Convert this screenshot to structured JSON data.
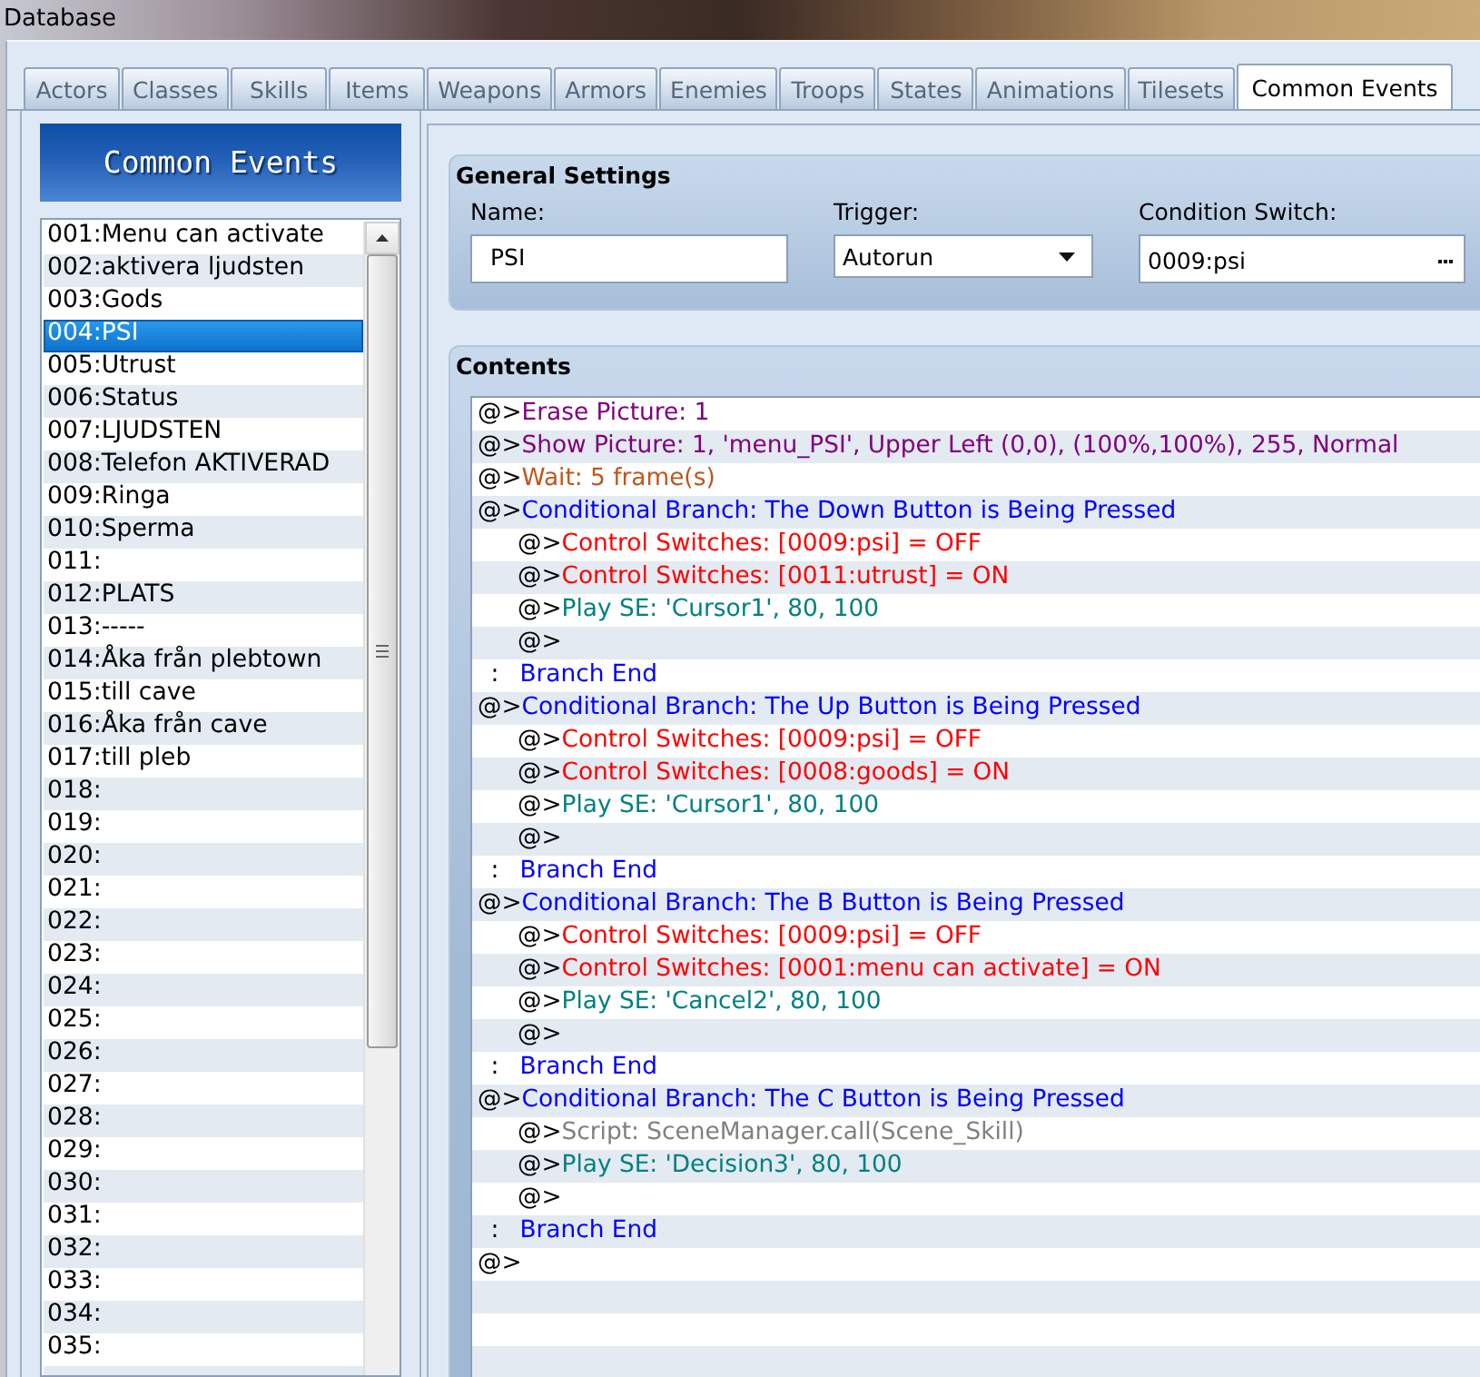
{
  "window": {
    "title": "Database"
  },
  "tabs": [
    {
      "label": "Actors",
      "selected": false
    },
    {
      "label": "Classes",
      "selected": false
    },
    {
      "label": "Skills",
      "selected": false
    },
    {
      "label": "Items",
      "selected": false
    },
    {
      "label": "Weapons",
      "selected": false
    },
    {
      "label": "Armors",
      "selected": false
    },
    {
      "label": "Enemies",
      "selected": false
    },
    {
      "label": "Troops",
      "selected": false
    },
    {
      "label": "States",
      "selected": false
    },
    {
      "label": "Animations",
      "selected": false
    },
    {
      "label": "Tilesets",
      "selected": false
    },
    {
      "label": "Common Events",
      "selected": true
    }
  ],
  "sidebar": {
    "title": "Common Events",
    "items": [
      {
        "label": "001:Menu can activate",
        "selected": false
      },
      {
        "label": "002:aktivera ljudsten",
        "selected": false
      },
      {
        "label": "003:Gods",
        "selected": false
      },
      {
        "label": "004:PSI",
        "selected": true
      },
      {
        "label": "005:Utrust",
        "selected": false
      },
      {
        "label": "006:Status",
        "selected": false
      },
      {
        "label": "007:LJUDSTEN",
        "selected": false
      },
      {
        "label": "008:Telefon AKTIVERAD",
        "selected": false
      },
      {
        "label": "009:Ringa",
        "selected": false
      },
      {
        "label": "010:Sperma",
        "selected": false
      },
      {
        "label": "011:",
        "selected": false
      },
      {
        "label": "012:PLATS",
        "selected": false
      },
      {
        "label": "013:-----",
        "selected": false
      },
      {
        "label": "014:Åka från plebtown",
        "selected": false
      },
      {
        "label": "015:till cave",
        "selected": false
      },
      {
        "label": "016:Åka från cave",
        "selected": false
      },
      {
        "label": "017:till pleb",
        "selected": false
      },
      {
        "label": "018:",
        "selected": false
      },
      {
        "label": "019:",
        "selected": false
      },
      {
        "label": "020:",
        "selected": false
      },
      {
        "label": "021:",
        "selected": false
      },
      {
        "label": "022:",
        "selected": false
      },
      {
        "label": "023:",
        "selected": false
      },
      {
        "label": "024:",
        "selected": false
      },
      {
        "label": "025:",
        "selected": false
      },
      {
        "label": "026:",
        "selected": false
      },
      {
        "label": "027:",
        "selected": false
      },
      {
        "label": "028:",
        "selected": false
      },
      {
        "label": "029:",
        "selected": false
      },
      {
        "label": "030:",
        "selected": false
      },
      {
        "label": "031:",
        "selected": false
      },
      {
        "label": "032:",
        "selected": false
      },
      {
        "label": "033:",
        "selected": false
      },
      {
        "label": "034:",
        "selected": false
      },
      {
        "label": "035:",
        "selected": false
      }
    ]
  },
  "general_settings": {
    "title": "General Settings",
    "name": {
      "label": "Name:",
      "value": "PSI"
    },
    "trigger": {
      "label": "Trigger:",
      "value": "Autorun"
    },
    "condition_switch": {
      "label": "Condition Switch:",
      "value": "0009:psi"
    }
  },
  "contents": {
    "title": "Contents",
    "commands": [
      {
        "kind": "command",
        "marker": "@>",
        "text": "Erase Picture: 1",
        "color": "#800080"
      },
      {
        "kind": "command",
        "marker": "@>",
        "text": "Show Picture: 1, 'menu_PSI', Upper Left (0,0), (100%,100%), 255, Normal",
        "color": "#800080"
      },
      {
        "kind": "command",
        "marker": "@>",
        "text": "Wait: 5 frame(s)",
        "color": "#c0561b"
      },
      {
        "kind": "command",
        "marker": "@>",
        "text": "Conditional Branch: The Down Button is Being Pressed",
        "color": "#0000ff",
        "children": [
          {
            "kind": "command",
            "marker": "@>",
            "text": "Control Switches: [0009:psi] = OFF",
            "color": "#ff0000"
          },
          {
            "kind": "command",
            "marker": "@>",
            "text": "Control Switches: [0011:utrust] = ON",
            "color": "#ff0000"
          },
          {
            "kind": "command",
            "marker": "@>",
            "text": "Play SE: 'Cursor1', 80, 100",
            "color": "#008080"
          },
          {
            "kind": "command",
            "marker": "@>"
          }
        ]
      },
      {
        "kind": "branch_end",
        "marker": ":",
        "text": "Branch End",
        "color": "#0000ff"
      },
      {
        "kind": "command",
        "marker": "@>",
        "text": "Conditional Branch: The Up Button is Being Pressed",
        "color": "#0000ff",
        "children": [
          {
            "kind": "command",
            "marker": "@>",
            "text": "Control Switches: [0009:psi] = OFF",
            "color": "#ff0000"
          },
          {
            "kind": "command",
            "marker": "@>",
            "text": "Control Switches: [0008:goods] = ON",
            "color": "#ff0000"
          },
          {
            "kind": "command",
            "marker": "@>",
            "text": "Play SE: 'Cursor1', 80, 100",
            "color": "#008080"
          },
          {
            "kind": "command",
            "marker": "@>"
          }
        ]
      },
      {
        "kind": "branch_end",
        "marker": ":",
        "text": "Branch End",
        "color": "#0000ff"
      },
      {
        "kind": "command",
        "marker": "@>",
        "text": "Conditional Branch: The B Button is Being Pressed",
        "color": "#0000ff",
        "children": [
          {
            "kind": "command",
            "marker": "@>",
            "text": "Control Switches: [0009:psi] = OFF",
            "color": "#ff0000"
          },
          {
            "kind": "command",
            "marker": "@>",
            "text": "Control Switches: [0001:menu can activate] = ON",
            "color": "#ff0000"
          },
          {
            "kind": "command",
            "marker": "@>",
            "text": "Play SE: 'Cancel2', 80, 100",
            "color": "#008080"
          },
          {
            "kind": "command",
            "marker": "@>"
          }
        ]
      },
      {
        "kind": "branch_end",
        "marker": ":",
        "text": "Branch End",
        "color": "#0000ff"
      },
      {
        "kind": "command",
        "marker": "@>",
        "text": "Conditional Branch: The C Button is Being Pressed",
        "color": "#0000ff",
        "children": [
          {
            "kind": "command",
            "marker": "@>",
            "text": "Script: SceneManager.call(Scene_Skill)",
            "color": "#808080"
          },
          {
            "kind": "command",
            "marker": "@>",
            "text": "Play SE: 'Decision3', 80, 100",
            "color": "#008080"
          },
          {
            "kind": "command",
            "marker": "@>"
          }
        ]
      },
      {
        "kind": "branch_end",
        "marker": ":",
        "text": "Branch End",
        "color": "#0000ff"
      },
      {
        "kind": "command",
        "marker": "@>"
      }
    ]
  }
}
